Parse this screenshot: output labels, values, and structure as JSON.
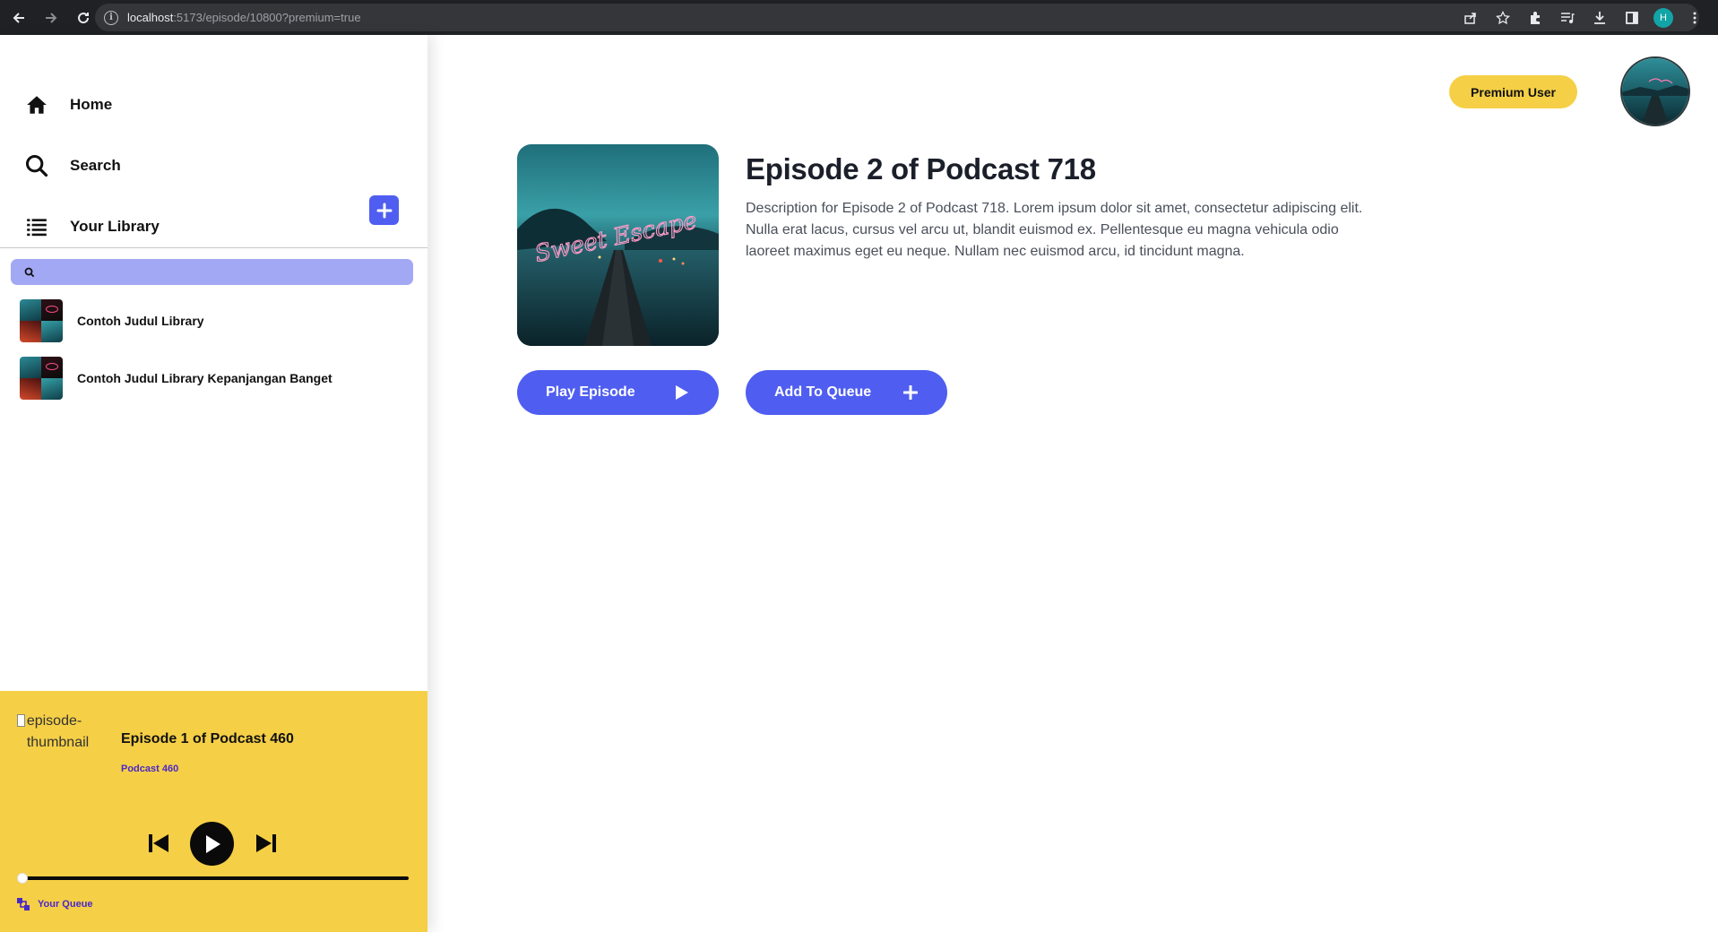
{
  "browser": {
    "url_host": "localhost",
    "url_path": ":5173/episode/10800?premium=true",
    "profile_initial": "H"
  },
  "sidebar": {
    "nav": [
      {
        "label": "Home",
        "icon": "home-icon"
      },
      {
        "label": "Search",
        "icon": "search-icon"
      },
      {
        "label": "Your Library",
        "icon": "library-list-icon"
      }
    ],
    "add_library_icon": "plus-icon",
    "library_search": {
      "placeholder": "",
      "value": ""
    },
    "library_items": [
      {
        "label": "Contoh Judul Library"
      },
      {
        "label": "Contoh Judul Library Kepanjangan Banget"
      }
    ]
  },
  "player": {
    "thumbnail_alt": "episode-thumbnail",
    "title": "Episode 1 of Podcast 460",
    "podcast": "Podcast 460",
    "progress": 0,
    "queue_label": "Your Queue"
  },
  "header": {
    "premium_badge": "Premium User"
  },
  "episode": {
    "title": "Episode 2 of Podcast 718",
    "description": "Description for Episode 2 of Podcast 718. Lorem ipsum dolor sit amet, consectetur adipiscing elit. Nulla erat lacus, cursus vel arcu ut, blandit euismod ex. Pellentesque eu magna vehicula odio laoreet maximus eget eu neque. Nullam nec euismod arcu, id tincidunt magna.",
    "cover_text": "Sweet Escape",
    "play_label": "Play Episode",
    "queue_label": "Add To Queue"
  },
  "colors": {
    "accent": "#4f5ef0",
    "yellow": "#f5cf46",
    "link_purple": "#4a28c7"
  }
}
